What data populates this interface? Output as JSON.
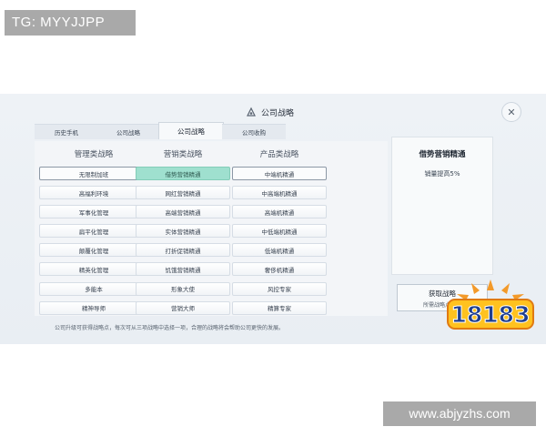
{
  "watermarks": {
    "top_left": "TG: MYYJJPP",
    "bottom_right": "www.abjyzhs.com"
  },
  "dialog": {
    "title": "公司战略",
    "close_symbol": "✕",
    "tabs": [
      {
        "label": "历史手机",
        "active": false
      },
      {
        "label": "公司战略",
        "active": false
      },
      {
        "label": "公司战略",
        "active": true
      },
      {
        "label": "公司收购",
        "active": false
      }
    ],
    "columns": [
      {
        "header": "管理类战略",
        "items": [
          "无限制加班",
          "高福利环境",
          "军事化管理",
          "扁平化管理",
          "颠覆化管理",
          "精英化管理",
          "多能本",
          "精神导师"
        ],
        "outlined_index": 0
      },
      {
        "header": "营销类战略",
        "items": [
          "借势营销精通",
          "网红营销精通",
          "高端营销精通",
          "实体营销精通",
          "打折促销精通",
          "饥饿营销精通",
          "形象大使",
          "营销大师"
        ],
        "active_index": 0
      },
      {
        "header": "产品类战略",
        "items": [
          "中端机精通",
          "中高端机精通",
          "高端机精通",
          "中低端机精通",
          "低端机精通",
          "奢侈机精通",
          "风控专家",
          "精算专家"
        ],
        "outlined_index": 0
      }
    ],
    "footnote": "公司升级可获得战略点，每次可从三项战略中选择一项，合理的战略将会帮助公司更快的发展。",
    "detail": {
      "title": "借势营销精通",
      "description": "销量提高5%"
    },
    "acquire": {
      "label": "获取战略",
      "sub": "所需战略点"
    }
  },
  "logo": {
    "text": "18183"
  },
  "colors": {
    "active_cell": "#9fe0cf",
    "panel_bg": "#eef2f6",
    "watermark_bg": "#a9a9a9"
  }
}
